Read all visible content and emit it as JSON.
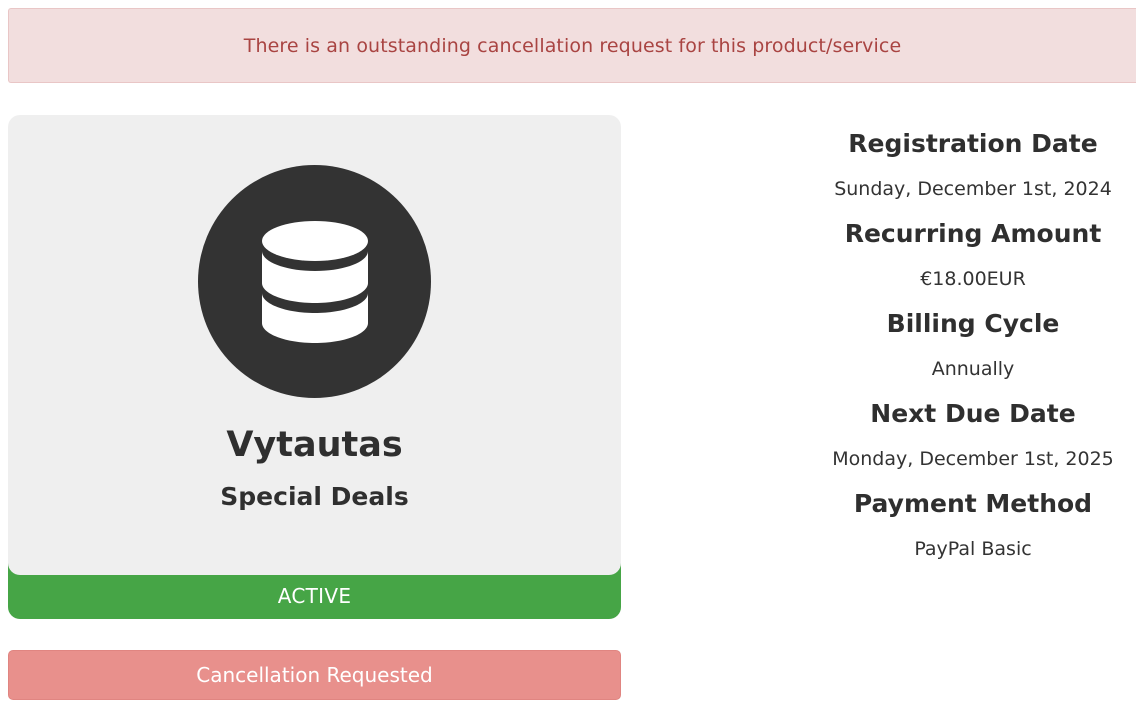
{
  "alert": {
    "message": "There is an outstanding cancellation request for this product/service"
  },
  "product": {
    "icon": "database-icon",
    "name": "Vytautas",
    "group": "Special Deals",
    "status": "ACTIVE",
    "status_color": "#46a546"
  },
  "actions": {
    "cancel_label": "Cancellation Requested",
    "cancel_color": "#e8908c"
  },
  "details": [
    {
      "label": "Registration Date",
      "value": "Sunday, December 1st, 2024"
    },
    {
      "label": "Recurring Amount",
      "value": "€18.00EUR"
    },
    {
      "label": "Billing Cycle",
      "value": "Annually"
    },
    {
      "label": "Next Due Date",
      "value": "Monday, December 1st, 2025"
    },
    {
      "label": "Payment Method",
      "value": "PayPal Basic"
    }
  ]
}
